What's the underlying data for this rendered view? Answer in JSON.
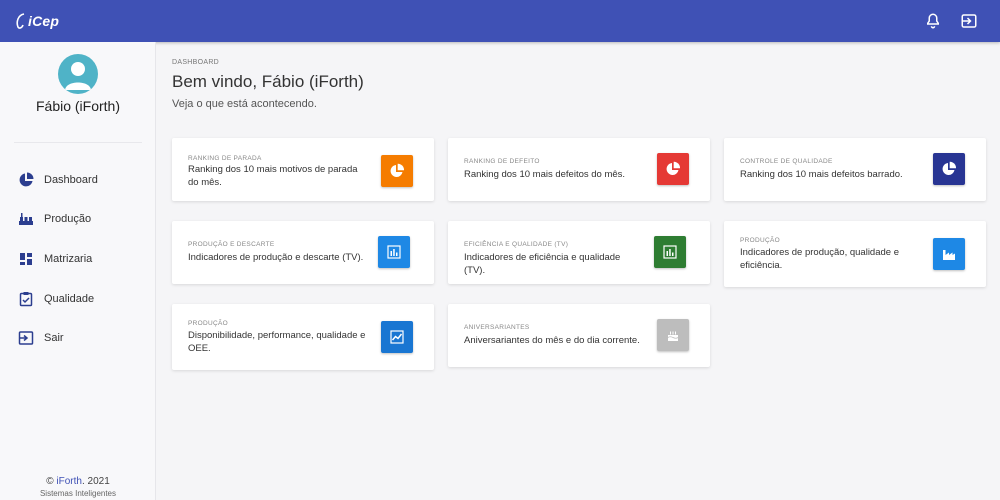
{
  "app": {
    "logo": "iCep"
  },
  "user": {
    "name": "Fábio (iForth)"
  },
  "sidebar": {
    "items": [
      {
        "label": "Dashboard",
        "icon": "pie-chart-icon"
      },
      {
        "label": "Produção",
        "icon": "factory-icon"
      },
      {
        "label": "Matrizaria",
        "icon": "grid-icon"
      },
      {
        "label": "Qualidade",
        "icon": "clipboard-check-icon"
      },
      {
        "label": "Sair",
        "icon": "logout-icon"
      }
    ]
  },
  "footer": {
    "copyright": "© ",
    "brand": "iForth",
    "year": ". 2021",
    "tagline": "Sistemas Inteligentes"
  },
  "header": {
    "breadcrumb": "DASHBOARD",
    "title": "Bem vindo, Fábio (iForth)",
    "subtitle": "Veja o que está acontecendo."
  },
  "cards": [
    {
      "category": "RANKING DE PARADA",
      "description": "Ranking dos 10 mais motivos de parada do mês.",
      "icon": "pie-chart-icon",
      "color": "#f57c00"
    },
    {
      "category": "RANKING DE DEFEITO",
      "description": "Ranking dos 10 mais defeitos do mês.",
      "icon": "pie-chart-icon",
      "color": "#e53935"
    },
    {
      "category": "CONTROLE DE QUALIDADE",
      "description": "Ranking dos 10 mais defeitos barrado.",
      "icon": "pie-chart-icon",
      "color": "#283593"
    },
    {
      "category": "PRODUÇÃO E DESCARTE",
      "description": "Indicadores de produção e descarte (TV).",
      "icon": "bar-chart-icon",
      "color": "#1e88e5"
    },
    {
      "category": "EFICIÊNCIA E QUALIDADE (TV)",
      "description": "Indicadores de eficiência e qualidade (TV).",
      "icon": "bar-chart-icon",
      "color": "#2e7d32"
    },
    {
      "category": "PRODUÇÃO",
      "description": "Indicadores de produção, qualidade e eficiência.",
      "icon": "factory-icon",
      "color": "#1e88e5"
    },
    {
      "category": "PRODUÇÃO",
      "description": "Disponibilidade, performance, qualidade e OEE.",
      "icon": "line-chart-icon",
      "color": "#1976d2"
    },
    {
      "category": "ANIVERSARIANTES",
      "description": "Aniversariantes do mês e do dia corrente.",
      "icon": "cake-icon",
      "color": "#bdbdbd"
    }
  ]
}
